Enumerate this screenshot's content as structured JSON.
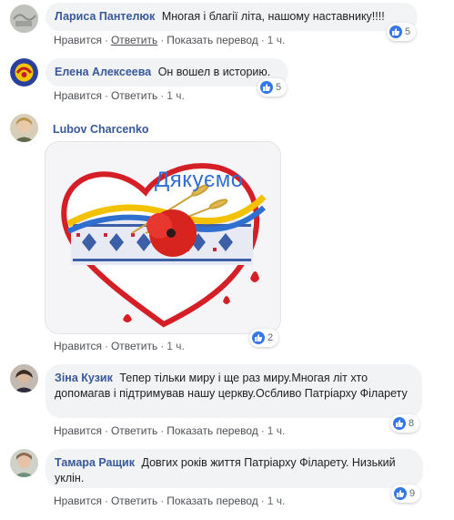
{
  "comments": [
    {
      "author": "Лариса Пантелюк",
      "text": "Многая і благії літа, нашому наставнику!!!!",
      "actions": {
        "like": "Нравится",
        "reply": "Ответить",
        "translate": "Показать перевод",
        "time": "1 ч."
      },
      "reactions": "5"
    },
    {
      "author": "Елена Алексеева",
      "text": "Он вошел в историю.",
      "actions": {
        "like": "Нравится",
        "reply": "Ответить",
        "time": "1 ч."
      },
      "reactions": "5"
    },
    {
      "author": "Lubov Charcenko",
      "image_text": "Дякуємо",
      "actions": {
        "like": "Нравится",
        "reply": "Ответить",
        "time": "1 ч."
      },
      "reactions": "2"
    },
    {
      "author": "Зіна Кузик",
      "text": "Тепер тільки миру і ще раз миру.Многая літ хто допомагав і підтримував нашу церкву.Осбливо Патріарху Філарету",
      "actions": {
        "like": "Нравится",
        "reply": "Ответить",
        "translate": "Показать перевод",
        "time": "1 ч."
      },
      "reactions": "8"
    },
    {
      "author": "Тамара Ращик",
      "text": "Довгих років життя Патріарху Філарету. Низький уклін.",
      "actions": {
        "like": "Нравится",
        "reply": "Ответить",
        "translate": "Показать перевод",
        "time": "1 ч."
      },
      "reactions": "9"
    }
  ],
  "colors": {
    "name": "#385898",
    "bubble": "#f2f3f5",
    "like_blue": "#3578e5",
    "meta": "#606770"
  },
  "icons": {
    "reaction": "thumbs-up-icon"
  }
}
